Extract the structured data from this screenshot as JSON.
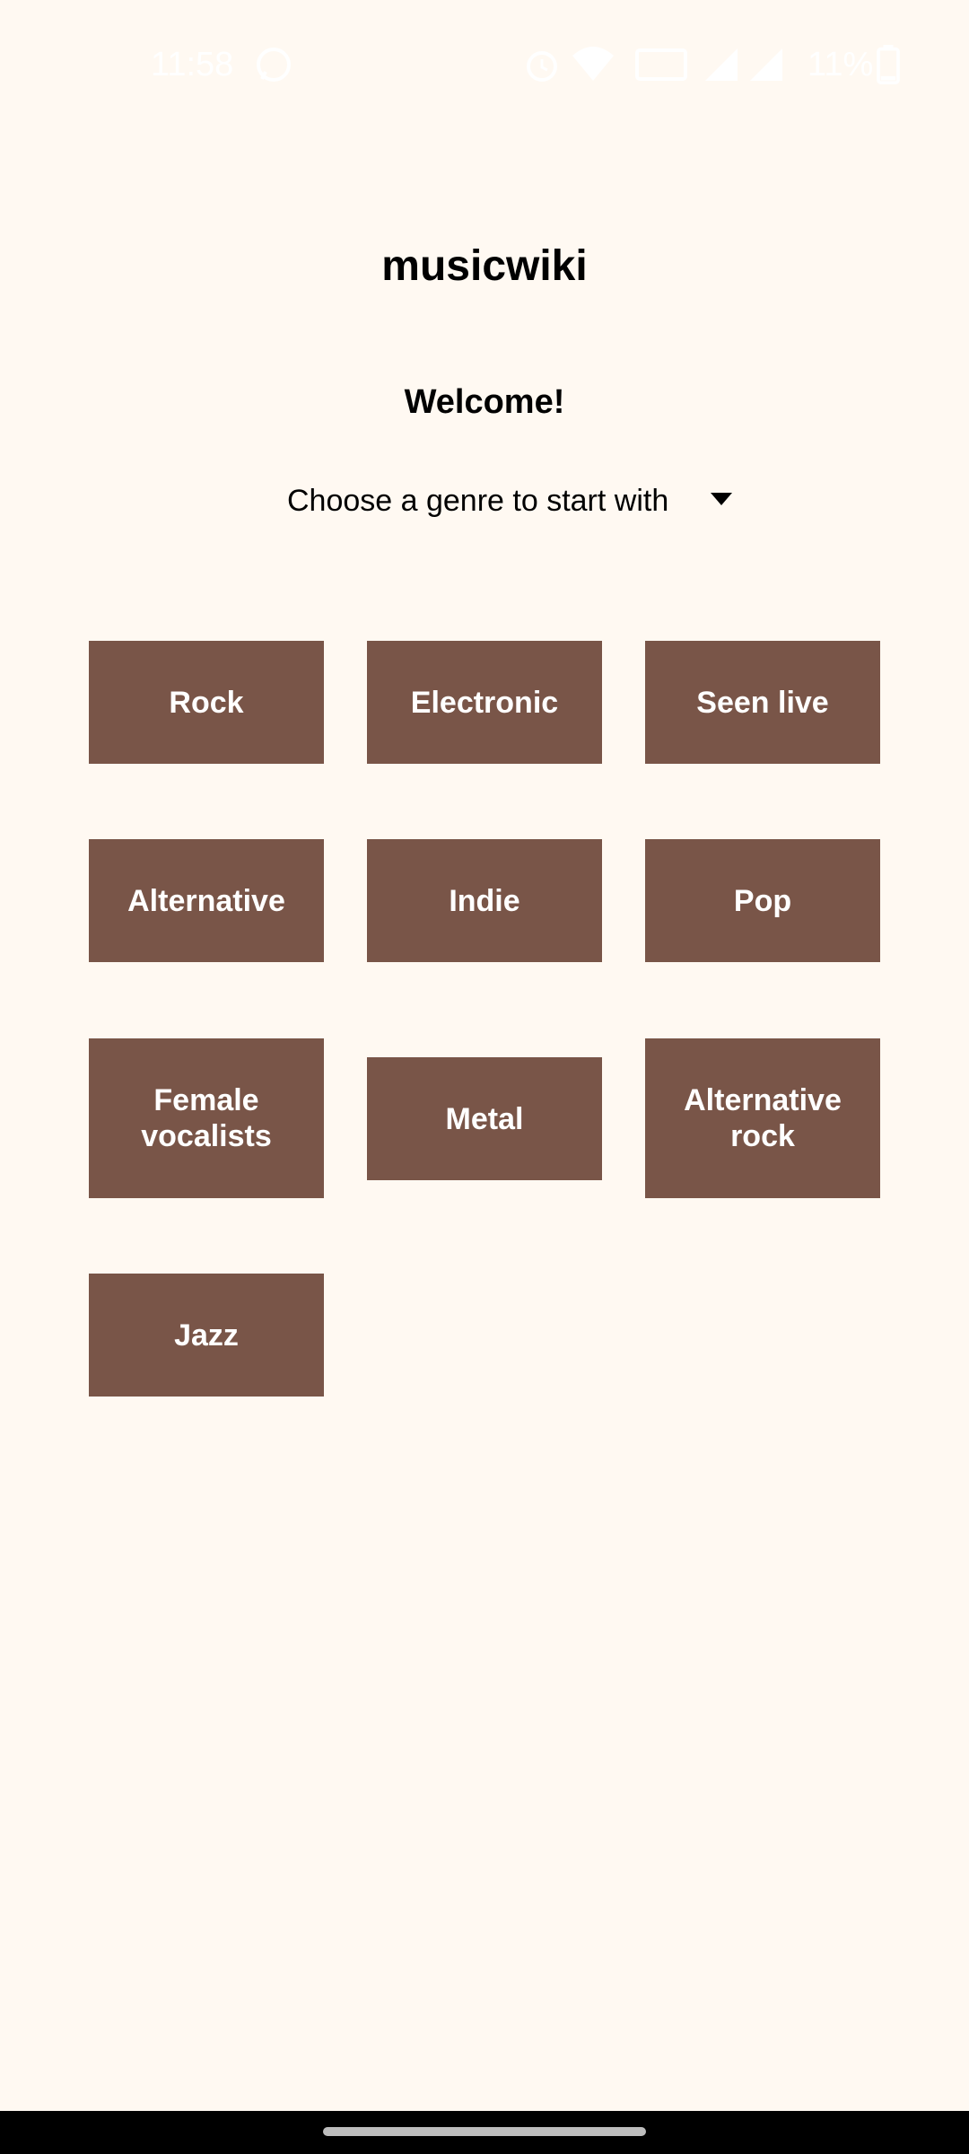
{
  "status_bar": {
    "time": "11:58",
    "battery": "11%",
    "icons": [
      "whatsapp-icon",
      "alarm-icon",
      "wifi-icon",
      "volte-icon",
      "signal-icon",
      "signal-icon",
      "battery-icon"
    ]
  },
  "header": {
    "title": "musicwiki",
    "welcome": "Welcome!"
  },
  "genre_select": {
    "label": "Choose a genre to start with",
    "icon": "dropdown-arrow-icon"
  },
  "genres": [
    {
      "label": "Rock"
    },
    {
      "label": "Electronic"
    },
    {
      "label": "Seen live"
    },
    {
      "label": "Alternative"
    },
    {
      "label": "Indie"
    },
    {
      "label": "Pop"
    },
    {
      "label": "Female vocalists"
    },
    {
      "label": "Metal"
    },
    {
      "label": "Alternative rock"
    },
    {
      "label": "Jazz"
    }
  ],
  "colors": {
    "background": "#fff9f2",
    "button": "#795548",
    "button_text": "#ffffff"
  }
}
